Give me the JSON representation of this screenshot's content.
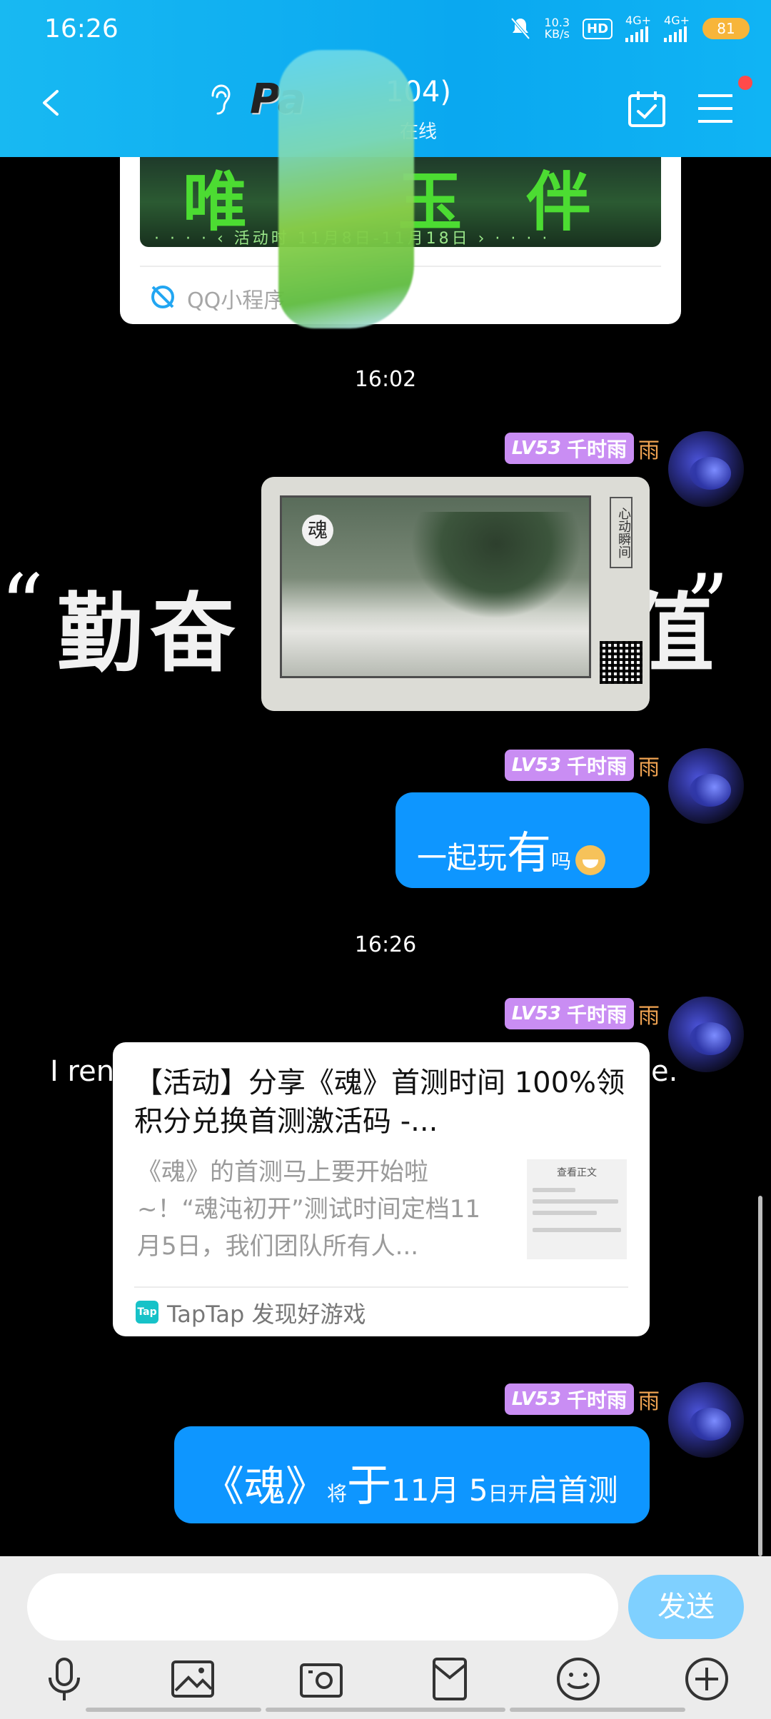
{
  "status_bar": {
    "time": "16:26",
    "net_speed_value": "10.3",
    "net_speed_unit": "KB/s",
    "hd": "HD",
    "sim1": "4G+",
    "sim2": "4G+",
    "battery": "81"
  },
  "header": {
    "title_logo": "Pa",
    "title_suffix": "104)",
    "subtitle": "在线",
    "has_notification": true
  },
  "mini_program_card": {
    "banner_big": "唯  玉伴",
    "banner_small": "· · · · ‹ 活动时  11月8日-11月18日 › · · · ·",
    "label": "QQ小程序"
  },
  "background_text": {
    "quote_left": "“",
    "big_left": "勤奋",
    "big_right": "值",
    "quote_right": "”",
    "line_left": "I ren",
    "line_right": "e."
  },
  "messages": [
    {
      "type": "time",
      "text": "16:02"
    },
    {
      "type": "image",
      "sender": {
        "level": "LV53",
        "name": "千时雨",
        "tail": "雨"
      },
      "image": {
        "seal": "魂",
        "side_title": "心动瞬间"
      }
    },
    {
      "type": "text",
      "sender": {
        "level": "LV53",
        "name": "千时雨",
        "tail": "雨"
      },
      "parts": {
        "a": "一起玩",
        "b": "有",
        "c": "吗"
      }
    },
    {
      "type": "time",
      "text": "16:26"
    },
    {
      "type": "link",
      "sender": {
        "level": "LV53",
        "name": "千时雨",
        "tail": "雨"
      },
      "title": "【活动】分享《魂》首测时间 100%领积分兑换首测激活码 -...",
      "description": "《魂》的首测马上要开始啦~！“魂沌初开”测试时间定档11月5日，我们团队所有人...",
      "thumb_head": "查看正文",
      "source_icon": "Tap",
      "source": "TapTap 发现好游戏"
    },
    {
      "type": "text",
      "sender": {
        "level": "LV53",
        "name": "千时雨",
        "tail": "雨"
      },
      "parts": {
        "a": "《魂》",
        "b": "将",
        "c": "于",
        "d": "11月 5",
        "e": "日开",
        "f": "启首测"
      }
    }
  ],
  "input": {
    "placeholder": "",
    "send_label": "发送"
  },
  "toolbar": [
    "voice-icon",
    "image-icon",
    "camera-icon",
    "red-packet-icon",
    "emoji-icon",
    "plus-icon"
  ],
  "colors": {
    "header": "#10b0f2",
    "bubble": "#0e96ff",
    "send": "#7fd0ff",
    "level_badge": "#c98df3"
  }
}
